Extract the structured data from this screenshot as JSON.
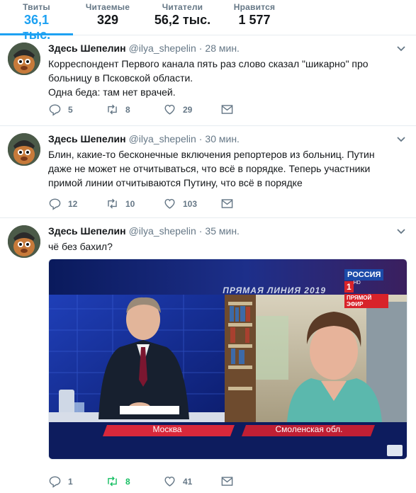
{
  "stats": [
    {
      "label": "Твиты",
      "value": "36,1 тыс."
    },
    {
      "label": "Читаемые",
      "value": "329"
    },
    {
      "label": "Читатели",
      "value": "56,2 тыс."
    },
    {
      "label": "Нравится",
      "value": "1 577"
    }
  ],
  "colors": {
    "accent": "#1da1f2",
    "retweet_active": "#17bf63",
    "muted": "#657786"
  },
  "tweets": [
    {
      "name": "Здесь Шепелин",
      "handle": "@ilya_shepelin",
      "time": "28 мин.",
      "lines": [
        "Корреспондент Первого канала пять раз слово сказал \"шикарно\" про больницу в Псковской области.",
        "Одна беда: там нет врачей."
      ],
      "replies": "5",
      "retweets": "8",
      "likes": "29"
    },
    {
      "name": "Здесь Шепелин",
      "handle": "@ilya_shepelin",
      "time": "30 мин.",
      "lines": [
        "Блин, какие-то бесконечные включения репортеров из больниц. Путин даже не может не отчитываться, что всё в порядке. Теперь участники примой линии отчитываются Путину, что всё в порядке"
      ],
      "replies": "12",
      "retweets": "10",
      "likes": "103"
    },
    {
      "name": "Здесь Шепелин",
      "handle": "@ilya_shepelin",
      "time": "35 мин.",
      "lines": [
        "чё без бахил?"
      ],
      "replies": "1",
      "retweets": "8",
      "likes": "41",
      "media": {
        "channel": "РОССИЯ",
        "channel_num": "1",
        "hd": "HD",
        "live": "ПРЯМОЙ ЭФИР",
        "show": "ПРЯМАЯ ЛИНИЯ 2019",
        "loc_left": "Москва",
        "loc_right": "Смоленская обл."
      }
    }
  ],
  "icons": [
    "reply-icon",
    "retweet-icon",
    "like-icon",
    "message-icon",
    "chevron-down-icon"
  ]
}
